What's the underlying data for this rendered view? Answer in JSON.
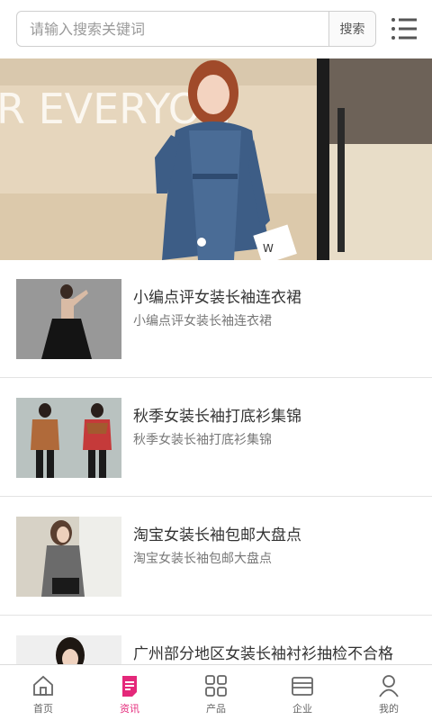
{
  "search": {
    "placeholder": "请输入搜索关键词",
    "button_label": "搜索",
    "value": ""
  },
  "banner": {
    "overlay_text": "R EVERYON",
    "bag_text": "W"
  },
  "articles": [
    {
      "title": "小编点评女装长袖连衣裙",
      "summary": "小编点评女装长袖连衣裙"
    },
    {
      "title": "秋季女装长袖打底衫集锦",
      "summary": "秋季女装长袖打底衫集锦"
    },
    {
      "title": "淘宝女装长袖包邮大盘点",
      "summary": "淘宝女装长袖包邮大盘点"
    },
    {
      "title": "广州部分地区女装长袖衬衫抽检不合格",
      "summary": ""
    }
  ],
  "tabbar": {
    "items": [
      {
        "label": "首页",
        "icon": "home-icon",
        "active": false
      },
      {
        "label": "资讯",
        "icon": "news-icon",
        "active": true
      },
      {
        "label": "产品",
        "icon": "grid-icon",
        "active": false
      },
      {
        "label": "企业",
        "icon": "store-icon",
        "active": false
      },
      {
        "label": "我的",
        "icon": "user-icon",
        "active": false
      }
    ]
  },
  "colors": {
    "accent": "#e4287a",
    "text": "#333333",
    "muted": "#777777"
  }
}
